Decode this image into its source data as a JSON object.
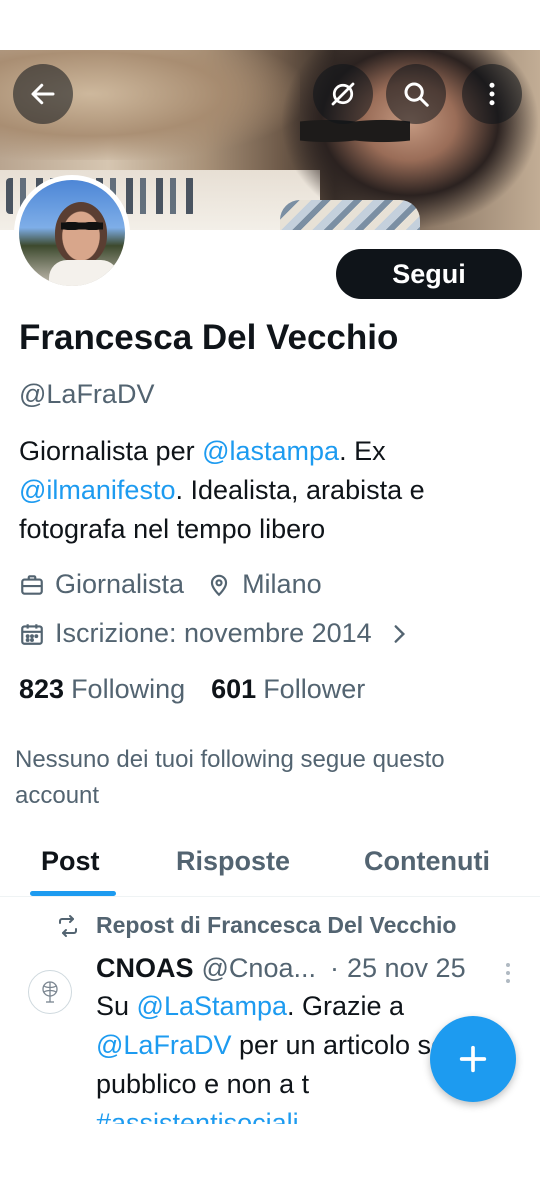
{
  "header": {
    "back_icon": "arrow-left-icon",
    "grok_icon": "grok-slash-circle-icon",
    "search_icon": "search-icon",
    "more_icon": "more-vertical-icon"
  },
  "profile": {
    "name": "Francesca Del Vecchio",
    "handle": "@LaFraDV",
    "follow_label": "Segui",
    "bio": {
      "part1": "Giornalista per ",
      "mention1": "@lastampa",
      "part2": ". Ex ",
      "mention2": "@ilmanifesto",
      "part3": ". Idealista, arabista e fotografa nel tempo libero"
    },
    "category": "Giornalista",
    "location": "Milano",
    "joined": "Iscrizione: novembre 2014",
    "following_count": "823",
    "following_label": "Following",
    "followers_count": "601",
    "followers_label": "Follower",
    "no_mutuals": "Nessuno dei tuoi following segue questo account"
  },
  "tabs": [
    {
      "label": "Post",
      "active": true
    },
    {
      "label": "Risposte",
      "active": false
    },
    {
      "label": "Contenuti",
      "active": false
    }
  ],
  "feed": {
    "repost_label": "Repost di Francesca Del Vecchio",
    "tweet": {
      "author_name": "CNOAS",
      "author_handle": "@Cnoa...",
      "separator": "·",
      "date": "25 nov 25",
      "text": {
        "t1": "Su ",
        "m1": "@LaStampa",
        "t2": ". Grazie a ",
        "m2": "@LaFraDV",
        "t3": "  per un articolo servizio pubblico e non a t",
        "hashtag": "#assistentisociali"
      }
    }
  },
  "colors": {
    "accent": "#1d9bf0",
    "text_primary": "#0f1419",
    "text_secondary": "#536471"
  },
  "fab_icon": "plus-icon"
}
